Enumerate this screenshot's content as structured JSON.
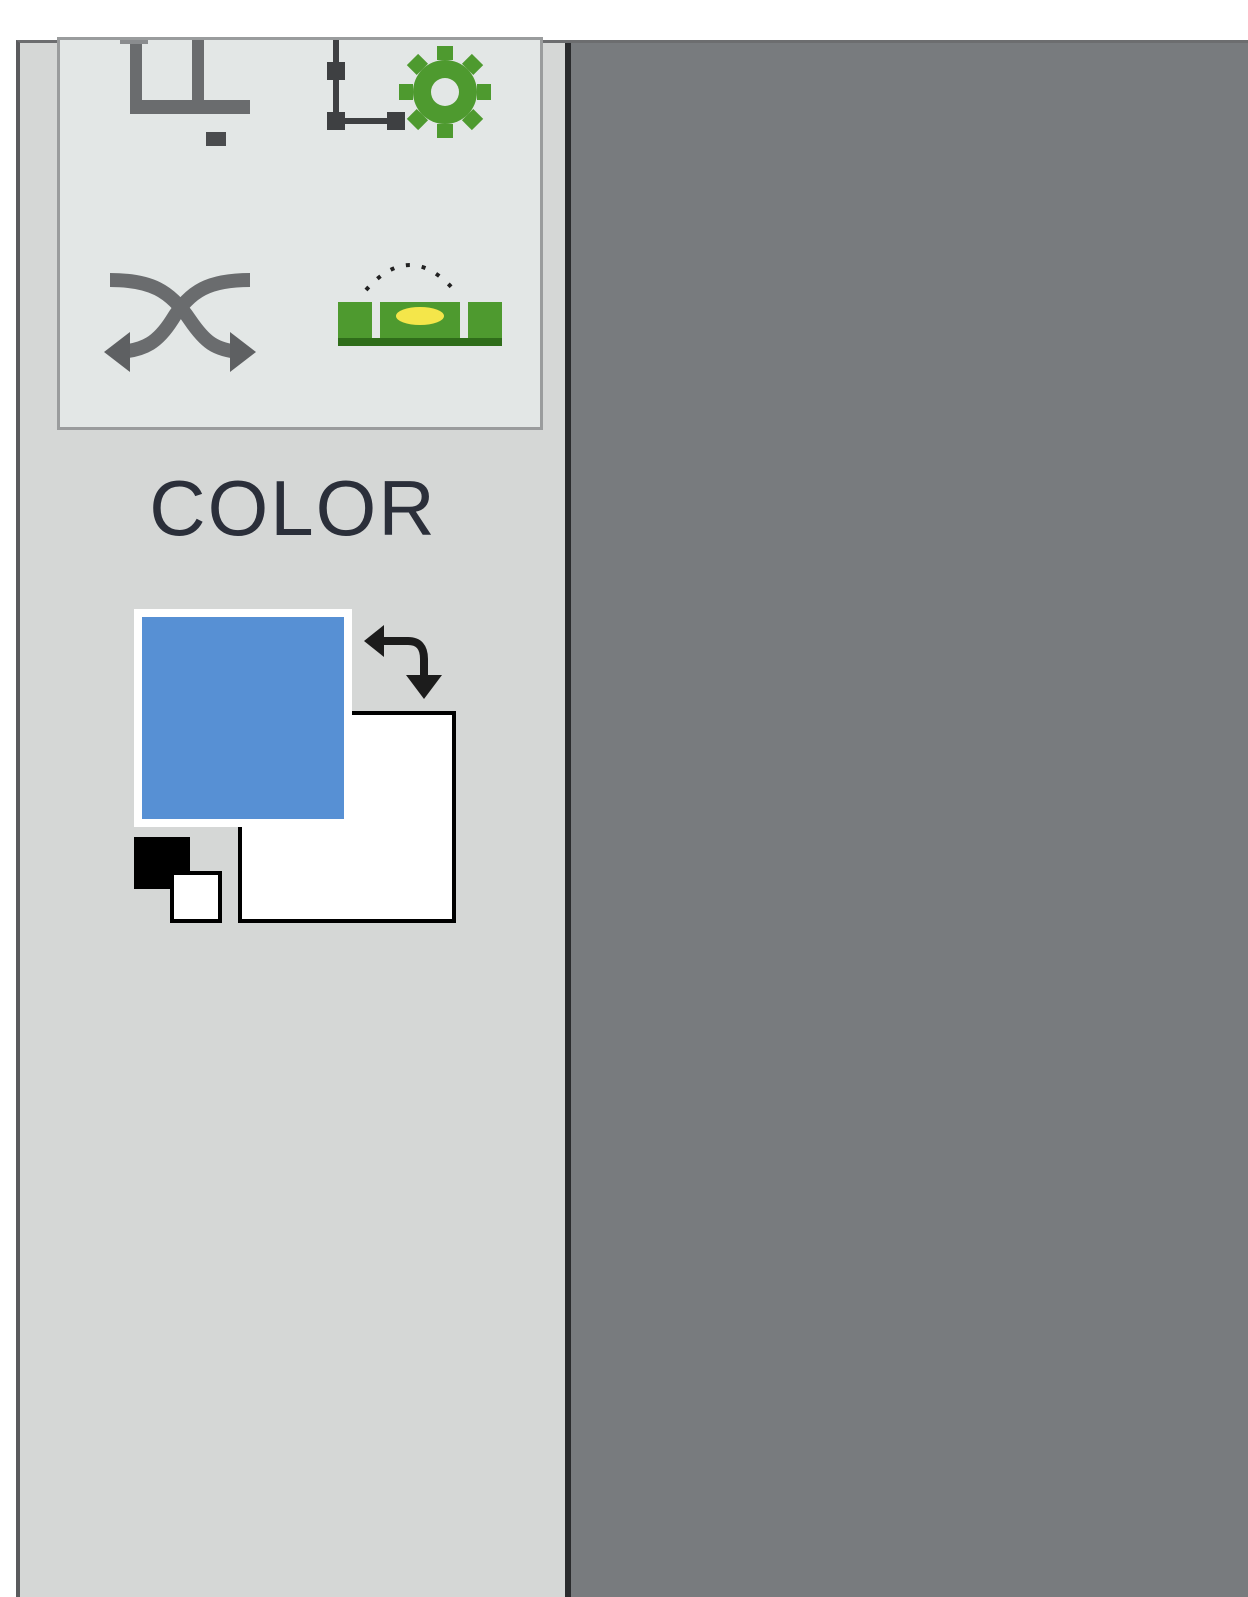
{
  "toolbox": {
    "tools": [
      {
        "name": "crop-icon"
      },
      {
        "name": "transform-settings-icon"
      },
      {
        "name": "flip-icon"
      },
      {
        "name": "level-icon"
      }
    ]
  },
  "color": {
    "label": "COLOR",
    "foreground": "#5790d4",
    "background": "#ffffff",
    "default_foreground": "#000000",
    "default_background": "#ffffff",
    "swap_icon": "swap-arrows-icon",
    "reset_icon": "default-colors-icon"
  },
  "theme": {
    "panel": "#d5d7d6",
    "canvas": "#787b7e",
    "accent_green": "#4e9a2f"
  }
}
